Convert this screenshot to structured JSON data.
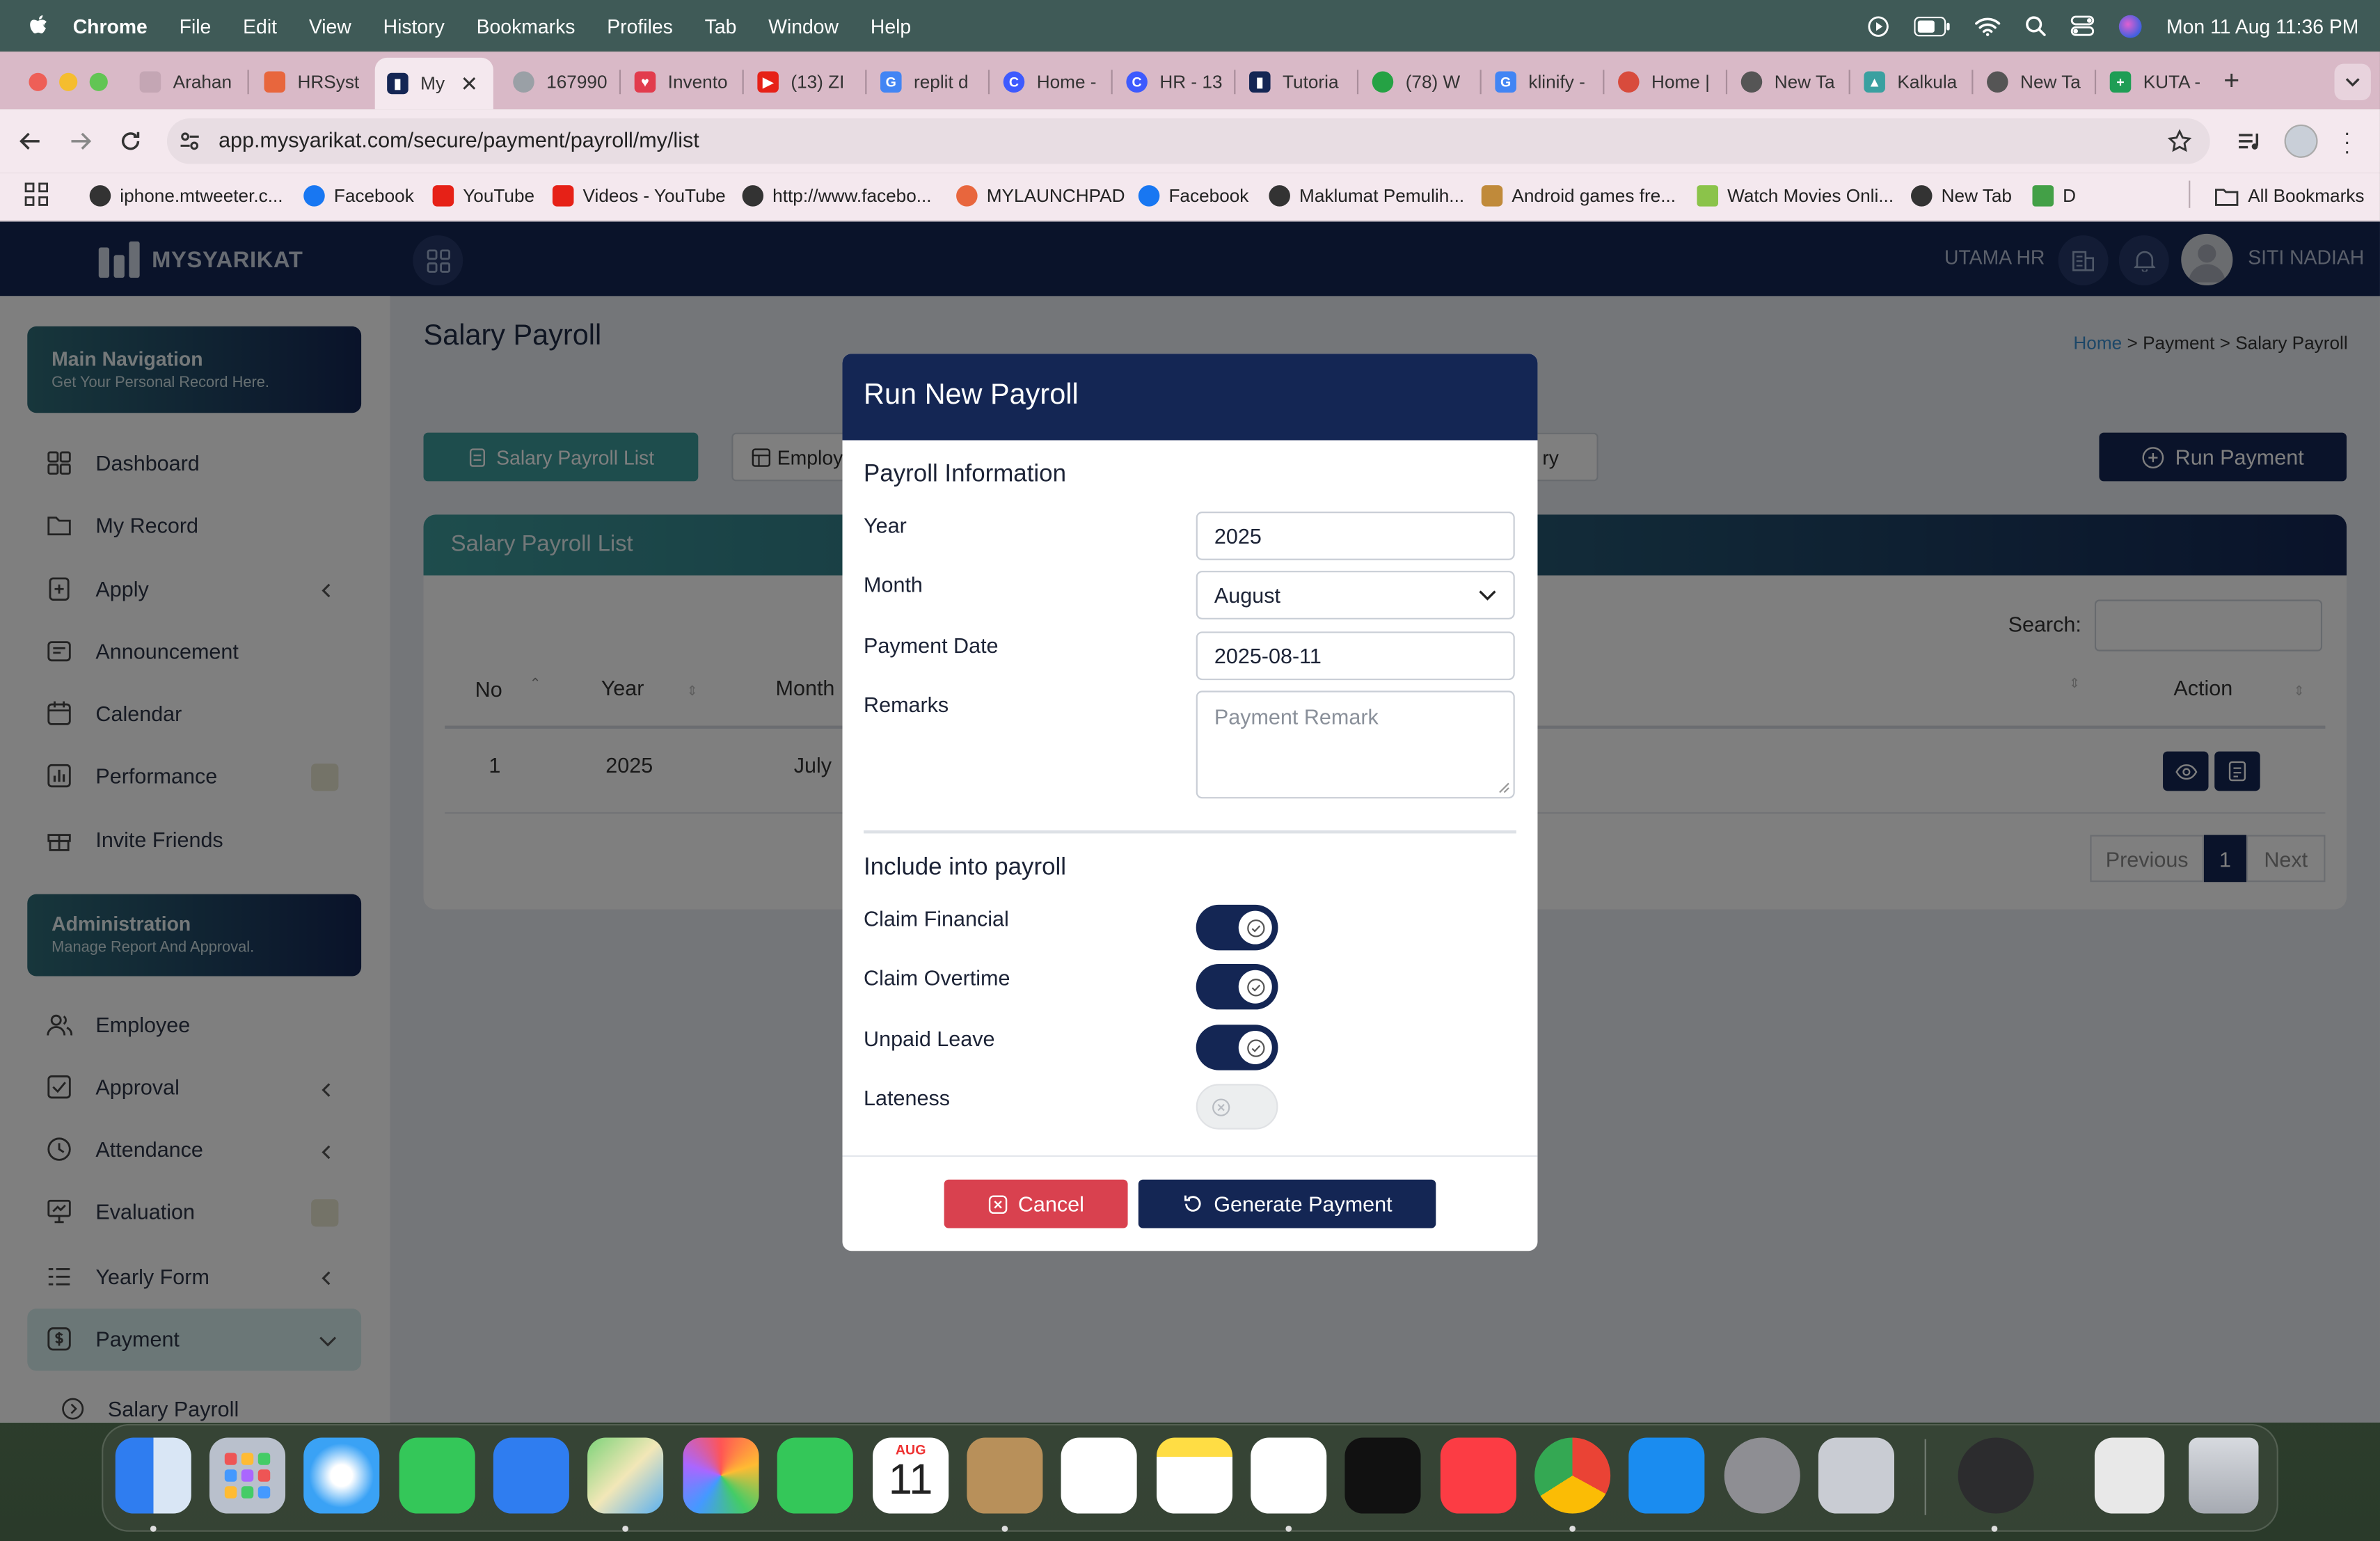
{
  "menubar": {
    "app": "Chrome",
    "items": [
      "File",
      "Edit",
      "View",
      "History",
      "Bookmarks",
      "Profiles",
      "Tab",
      "Window",
      "Help"
    ],
    "datetime": "Mon 11 Aug  11:36 PM"
  },
  "tabs": [
    {
      "title": "Arahan",
      "color": "#c4a6b4"
    },
    {
      "title": "HRSyst",
      "color": "#e8663d"
    },
    {
      "title": "My",
      "color": "#142654",
      "active": true
    },
    {
      "title": "167990",
      "color": "#9aa0a6"
    },
    {
      "title": "Invento",
      "color": "#e23c4d"
    },
    {
      "title": "(13) ZI",
      "color": "#e62117"
    },
    {
      "title": "replit d",
      "color": "#4285f4"
    },
    {
      "title": "Home -",
      "color": "#3d5afe"
    },
    {
      "title": "HR - 13",
      "color": "#3d5afe"
    },
    {
      "title": "Tutoria",
      "color": "#142654"
    },
    {
      "title": "(78) W",
      "color": "#25a244"
    },
    {
      "title": "klinify -",
      "color": "#4285f4"
    },
    {
      "title": "Home |",
      "color": "#d84b3c"
    },
    {
      "title": "New Ta",
      "color": "#555"
    },
    {
      "title": "Kalkula",
      "color": "#3aa0a0"
    },
    {
      "title": "New Ta",
      "color": "#555"
    },
    {
      "title": "KUTA -",
      "color": "#1f9d55"
    }
  ],
  "address": {
    "url": "app.mysyarikat.com/secure/payment/payroll/my/list"
  },
  "bookmarks": [
    {
      "label": "iphone.mtweeter.c...",
      "color": "#333"
    },
    {
      "label": "Facebook",
      "color": "#1877f2"
    },
    {
      "label": "YouTube",
      "color": "#e62117"
    },
    {
      "label": "Videos - YouTube",
      "color": "#e62117"
    },
    {
      "label": "http://www.facebo...",
      "color": "#333"
    },
    {
      "label": "MYLAUNCHPAD",
      "color": "#e8663d"
    },
    {
      "label": "Facebook",
      "color": "#1877f2"
    },
    {
      "label": "Maklumat Pemulih...",
      "color": "#333"
    },
    {
      "label": "Android games fre...",
      "color": "#c08a3a"
    },
    {
      "label": "Watch Movies Onli...",
      "color": "#8bc34a"
    },
    {
      "label": "New Tab",
      "color": "#333"
    },
    {
      "label": "D",
      "color": "#43a047"
    }
  ],
  "all_bookmarks": "All Bookmarks",
  "app": {
    "logo": "MYSYARIKAT",
    "company": "UTAMA HR",
    "user": "SITI NADIAH",
    "page_title": "Salary Payroll",
    "breadcrumb": {
      "home": "Home",
      "sep1": " > ",
      "payment": "Payment",
      "sep2": " > ",
      "current": "Salary Payroll"
    }
  },
  "sidebar": {
    "main_nav": {
      "title": "Main Navigation",
      "subtitle": "Get Your Personal Record Here."
    },
    "main_items": [
      {
        "label": "Dashboard"
      },
      {
        "label": "My Record"
      },
      {
        "label": "Apply"
      },
      {
        "label": "Announcement"
      },
      {
        "label": "Calendar"
      },
      {
        "label": "Performance"
      },
      {
        "label": "Invite Friends"
      }
    ],
    "admin": {
      "title": "Administration",
      "subtitle": "Manage Report And Approval."
    },
    "admin_items": [
      {
        "label": "Employee"
      },
      {
        "label": "Approval"
      },
      {
        "label": "Attendance"
      },
      {
        "label": "Evaluation"
      },
      {
        "label": "Yearly Form"
      },
      {
        "label": "Payment"
      },
      {
        "label": "Salary Payroll"
      }
    ]
  },
  "content": {
    "tabs": {
      "list": "Salary Payroll List",
      "employee": "Employ",
      "summary": "ry"
    },
    "run_payment": "Run Payment",
    "card_title": "Salary Payroll List",
    "search_label": "Search:",
    "columns": {
      "no": "No",
      "year": "Year",
      "month": "Month",
      "action": "Action"
    },
    "rows": [
      {
        "no": "1",
        "year": "2025",
        "month": "July"
      }
    ],
    "pagination": {
      "prev": "Previous",
      "page": "1",
      "next": "Next"
    }
  },
  "modal": {
    "title": "Run New Payroll",
    "section1": "Payroll Information",
    "year_label": "Year",
    "year_value": "2025",
    "month_label": "Month",
    "month_value": "August",
    "date_label": "Payment Date",
    "date_value": "2025-08-11",
    "remarks_label": "Remarks",
    "remarks_placeholder": "Payment Remark",
    "section2": "Include into payroll",
    "toggles": [
      {
        "label": "Claim Financial",
        "on": true
      },
      {
        "label": "Claim Overtime",
        "on": true
      },
      {
        "label": "Unpaid Leave",
        "on": true
      },
      {
        "label": "Lateness",
        "on": false
      }
    ],
    "cancel": "Cancel",
    "generate": "Generate Payment"
  },
  "dock": {
    "calendar_month": "AUG",
    "calendar_day": "11",
    "apps": [
      "finder",
      "launchpad",
      "safari",
      "messages",
      "mail",
      "maps",
      "photos",
      "facetime",
      "calendar",
      "contacts",
      "reminders",
      "notes",
      "freeform",
      "tv",
      "music",
      "chrome",
      "app-store",
      "settings",
      "iphone-mirroring",
      "quicktime",
      "preview",
      "trash"
    ]
  },
  "colors": {
    "navy": "#142654",
    "teal": "#3c9a9a",
    "danger": "#d9414f"
  }
}
